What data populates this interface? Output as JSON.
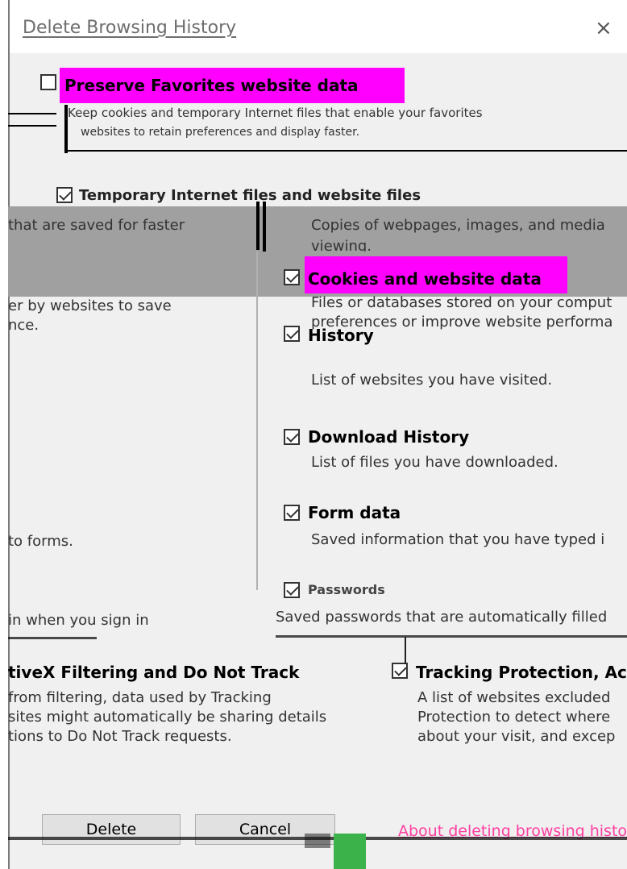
{
  "window": {
    "title": "Delete Browsing History",
    "close_glyph": "×"
  },
  "preserve": {
    "label": "Preserve Favorites website data",
    "desc_line1": "Keep cookies and temporary Internet files that enable your favorites",
    "desc_line2": "websites to retain preferences and display faster.",
    "checked": false
  },
  "temp_files": {
    "label": "Temporary Internet files and website files",
    "desc_line1": "Copies of webpages, images, and media",
    "desc_line2": "viewing.",
    "left_fragment": "that are saved for faster",
    "checked": true
  },
  "cookies": {
    "label": "Cookies and website data",
    "desc_line1": "Files or databases stored on your comput",
    "desc_line2": "preferences or improve website performa",
    "left_fragment1": "er by websites to save",
    "left_fragment2": "nce.",
    "checked": true
  },
  "history": {
    "label": "History",
    "desc": "List of websites you have visited.",
    "checked": true
  },
  "download_history": {
    "label": "Download History",
    "desc": "List of files you have downloaded.",
    "checked": true
  },
  "form_data": {
    "label": "Form data",
    "desc": "Saved information that you have typed i",
    "left_fragment": "to forms.",
    "checked": true
  },
  "passwords": {
    "label": "Passwords",
    "desc_line1": "Saved passwords that are automatically filled",
    "left_fragment1": "in when you sign in",
    "checked": true
  },
  "tracking": {
    "label": "Tracking Protection, Ac",
    "desc_line1": "A list of websites excluded",
    "desc_line2": "Protection to detect where",
    "desc_line3": "about your visit, and excep",
    "left_label": "tiveX Filtering and Do Not Track",
    "left_line1": "from filtering, data used by Tracking",
    "left_line2": "sites might automatically be sharing details",
    "left_line3": "tions to Do Not Track requests.",
    "checked": true
  },
  "buttons": {
    "delete": "Delete",
    "cancel": "Cancel"
  },
  "link": {
    "about": "About deleting browsing history"
  },
  "colors": {
    "highlight": "#ff00ff",
    "link": "#ff3ea0",
    "band": "#a0a0a0"
  }
}
